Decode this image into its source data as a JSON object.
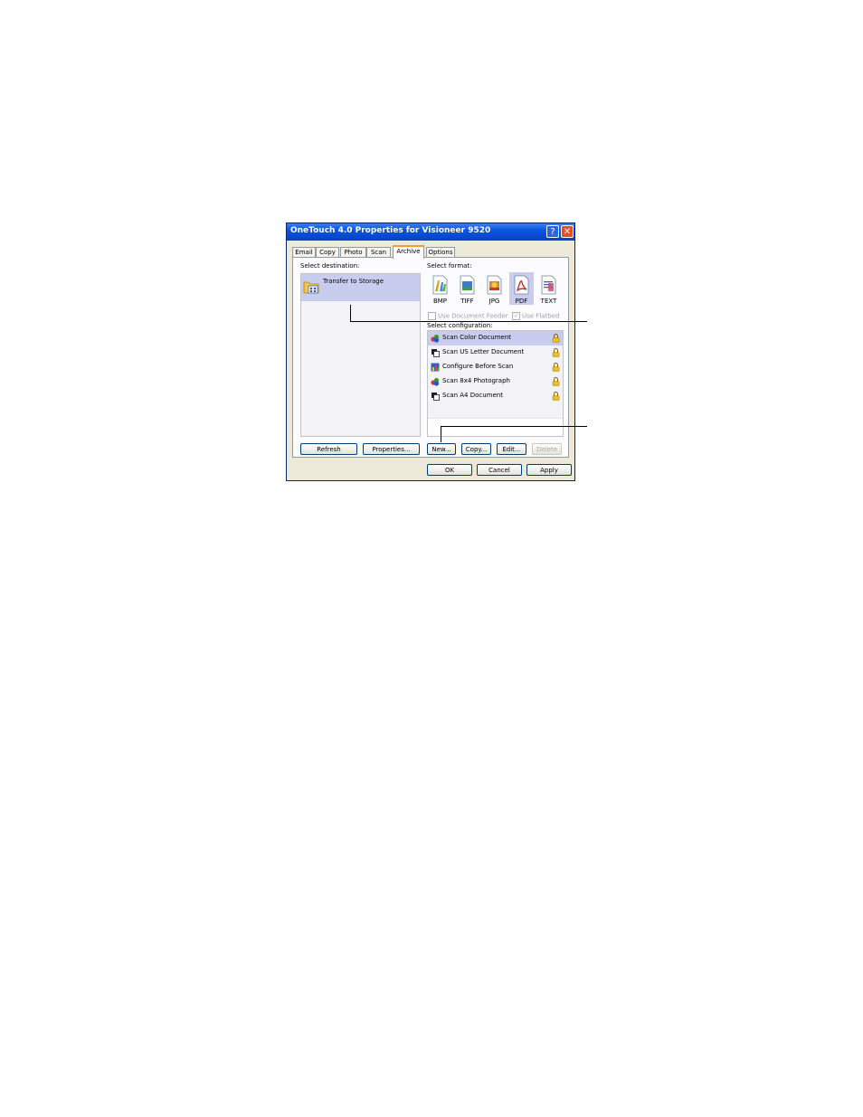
{
  "window": {
    "title": "OneTouch 4.0 Properties for Visioneer 9520",
    "help_glyph": "?",
    "close_glyph": "✕"
  },
  "tabs": [
    {
      "label": "Email"
    },
    {
      "label": "Copy"
    },
    {
      "label": "Photo"
    },
    {
      "label": "Scan"
    },
    {
      "label": "Archive",
      "active": true
    },
    {
      "label": "Options"
    }
  ],
  "destination": {
    "label": "Select destination:",
    "items": [
      {
        "label": "Transfer to Storage",
        "selected": true
      },
      {
        "label": ""
      },
      {
        "label": ""
      },
      {
        "label": ""
      },
      {
        "label": ""
      },
      {
        "label": ""
      }
    ],
    "refresh_label": "Refresh",
    "properties_label": "Properties..."
  },
  "format": {
    "label": "Select format:",
    "items": [
      {
        "label": "BMP",
        "icon": "bmp-icon"
      },
      {
        "label": "TIFF",
        "icon": "tiff-icon"
      },
      {
        "label": "JPG",
        "icon": "jpg-icon"
      },
      {
        "label": "PDF",
        "icon": "pdf-icon",
        "selected": true
      },
      {
        "label": "TEXT",
        "icon": "text-icon"
      }
    ],
    "use_feeder_label": "Use Document Feeder",
    "use_flatbed_label": "Use Flatbed",
    "use_feeder_checked": false,
    "use_flatbed_checked": true
  },
  "configuration": {
    "label": "Select configuration:",
    "items": [
      {
        "label": "Scan Color Document",
        "icon": "color-scan-icon",
        "selected": true
      },
      {
        "label": "Scan US Letter Document",
        "icon": "bw-document-icon"
      },
      {
        "label": "Configure Before Scan",
        "icon": "configure-icon"
      },
      {
        "label": "Scan 8x4 Photograph",
        "icon": "color-scan-icon"
      },
      {
        "label": "Scan A4 Document",
        "icon": "bw-document-icon"
      }
    ],
    "new_label": "New...",
    "copy_label": "Copy...",
    "edit_label": "Edit...",
    "delete_label": "Delete"
  },
  "footer": {
    "ok_label": "OK",
    "cancel_label": "Cancel",
    "apply_label": "Apply"
  },
  "colors": {
    "title_bar": "#0a55e0",
    "selection": "#c8cdf0",
    "active_tab_accent": "#f0a030"
  }
}
